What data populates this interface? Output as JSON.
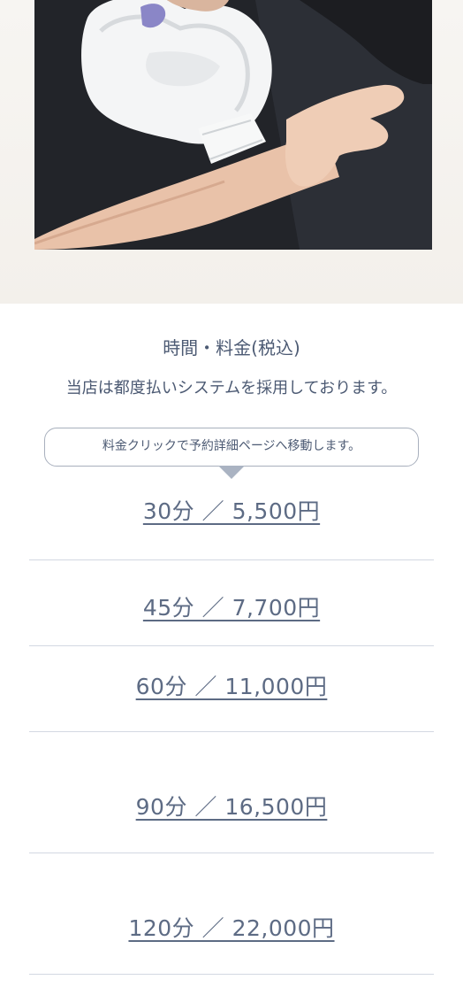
{
  "hero": {
    "photo_alt": "hair removal treatment"
  },
  "pricing": {
    "title": "時間・料金(税込)",
    "description": "当店は都度払いシステムを採用しております。",
    "notice": "料金クリックで予約詳細ページへ移動します。",
    "items": [
      {
        "label": "30分 ／ 5,500円"
      },
      {
        "label": "45分 ／ 7,700円"
      },
      {
        "label": "60分 ／ 11,000円"
      },
      {
        "label": "90分 ／ 16,500円"
      },
      {
        "label": "120分 ／ 22,000円"
      }
    ]
  },
  "colors": {
    "text": "#4c5a73",
    "link": "#5d6b84",
    "divider": "#d3d8e2",
    "bubble_border": "#a8b0bd"
  }
}
